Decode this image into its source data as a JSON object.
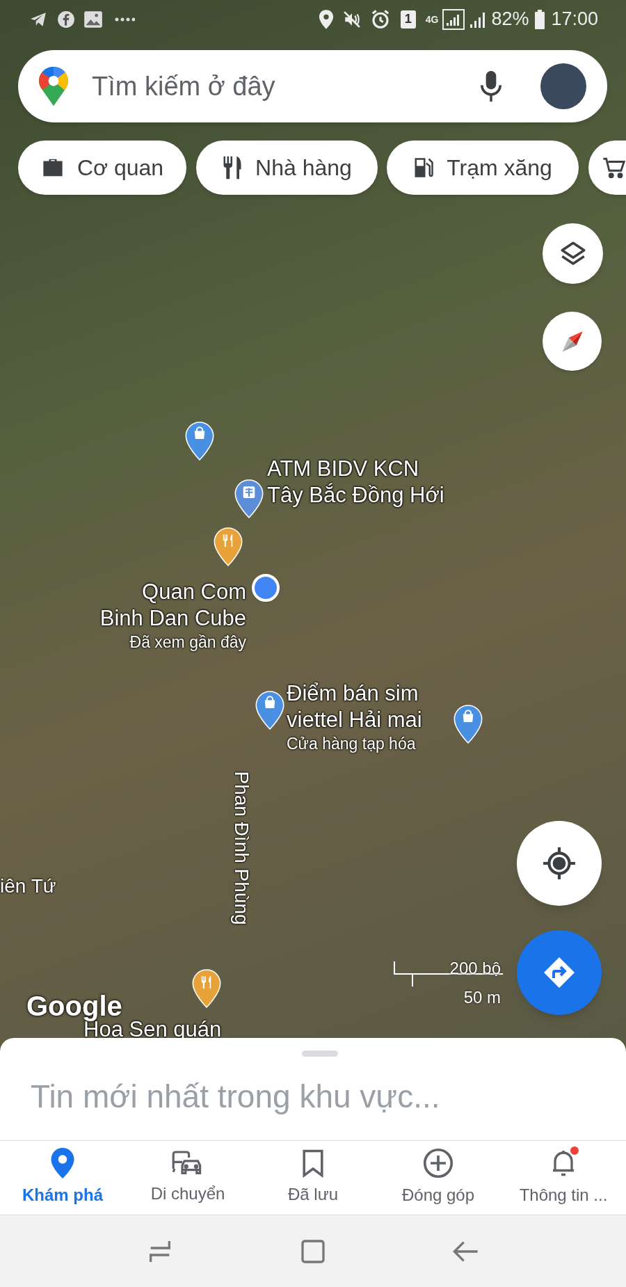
{
  "status_bar": {
    "sim": "1",
    "network": "4G",
    "battery": "82%",
    "time": "17:00"
  },
  "search": {
    "placeholder": "Tìm kiếm ở đây"
  },
  "chips": [
    "Cơ quan",
    "Nhà hàng",
    "Trạm xăng"
  ],
  "map": {
    "places": [
      {
        "kind": "shop"
      },
      {
        "kind": "atm",
        "name": [
          "ATM BIDV KCN",
          "Tây Bắc Đồng Hới"
        ]
      },
      {
        "kind": "restaurant",
        "name": [
          "Quan Com",
          "Binh Dan Cube"
        ],
        "subtitle": "Đã xem gần đây"
      },
      {
        "kind": "shop",
        "name": [
          "Điểm bán sim",
          "viettel Hải mai"
        ],
        "subtitle": "Cửa hàng tạp hóa"
      },
      {
        "kind": "shop"
      },
      {
        "kind": "restaurant",
        "name": [
          "Hoa Sen quán"
        ]
      }
    ],
    "streets": [
      "Phan Đình Phùng",
      "iên Tứ"
    ],
    "logo": "Google",
    "scale": {
      "imperial": "200 bộ",
      "metric": "50 m"
    }
  },
  "sheet": {
    "title": "Tin mới nhất trong khu vực..."
  },
  "nav": [
    {
      "label": "Khám phá",
      "selected": true,
      "notification": false
    },
    {
      "label": "Di chuyển",
      "selected": false,
      "notification": false
    },
    {
      "label": "Đã lưu",
      "selected": false,
      "notification": false
    },
    {
      "label": "Đóng góp",
      "selected": false,
      "notification": false
    },
    {
      "label": "Thông tin ...",
      "selected": false,
      "notification": true
    }
  ]
}
